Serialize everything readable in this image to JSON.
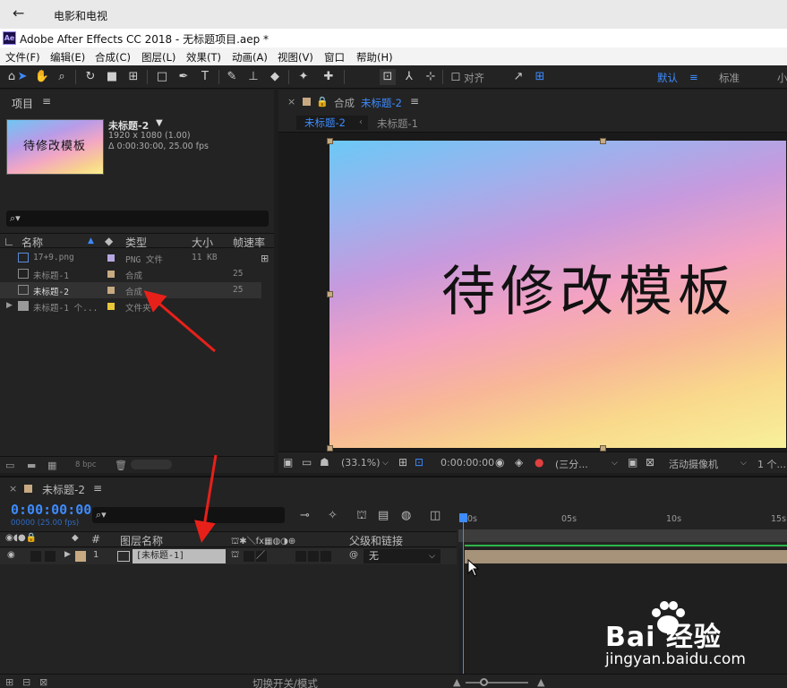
{
  "host": {
    "back_glyph": "←",
    "title": "电影和电视"
  },
  "app": {
    "logo": "Ae",
    "title": "Adobe After Effects CC 2018 - 无标题项目.aep *"
  },
  "menu": [
    "文件(F)",
    "编辑(E)",
    "合成(C)",
    "图层(L)",
    "效果(T)",
    "动画(A)",
    "视图(V)",
    "窗口",
    "帮助(H)"
  ],
  "toolbar": {
    "align_label": "对齐",
    "workspace_default": "默认",
    "workspace_standard": "标准",
    "workspace_small": "小"
  },
  "project": {
    "title": "项目",
    "selected_name": "未标题-2",
    "selected_dims": "1920 x 1080 (1.00)",
    "selected_dur": "Δ 0:00:30:00, 25.00 fps",
    "thumb_text": "待修改模板",
    "search_glyph": "⌕▾",
    "columns": {
      "name": "名称",
      "type": "类型",
      "size": "大小",
      "fps": "帧速率"
    },
    "items": [
      {
        "name": "17+9.png",
        "type": "PNG 文件",
        "size": "11 KB",
        "fps": "",
        "color": "#b6a6e0",
        "kind": "file"
      },
      {
        "name": "未标题-1",
        "type": "合成",
        "size": "",
        "fps": "25",
        "color": "#c7a982",
        "kind": "comp"
      },
      {
        "name": "未标题-2",
        "type": "合成",
        "size": "",
        "fps": "25",
        "color": "#c7a982",
        "kind": "comp"
      },
      {
        "name": "未标题-1 个...",
        "type": "文件夹",
        "size": "",
        "fps": "",
        "color": "#e8c73a",
        "kind": "folder"
      }
    ],
    "bpc": "8 bpc"
  },
  "comp": {
    "panel_label": "合成",
    "panel_active": "未标题-2",
    "tabs": [
      "未标题-2",
      "未标题-1"
    ],
    "viewer_text": "待修改模板",
    "zoom": "(33.1%)",
    "timecode": "0:00:00:00",
    "resolution": "(三分...",
    "camera": "活动摄像机",
    "views": "1 个..."
  },
  "timeline": {
    "tab_label": "未标题-2",
    "timecode": "0:00:00:00",
    "fps_note": "00000 (25.00 fps)",
    "search_glyph": "⌕▾",
    "columns": {
      "hash": "#",
      "layer_name": "图层名称",
      "parent": "父级和链接"
    },
    "layer": {
      "index": "1",
      "name": "[未标题-1]",
      "parent": "无"
    },
    "ruler": [
      "0s",
      "05s",
      "10s",
      "15s"
    ],
    "mode_label": "切换开关/模式"
  },
  "watermark": {
    "brand": "Bai 经验",
    "url": "jingyan.baidu.com"
  },
  "colors": {
    "accent": "#3d8bff",
    "comp_label": "#c7a982",
    "annotation": "#e8201a",
    "work_area_bar": "#2db64a"
  }
}
